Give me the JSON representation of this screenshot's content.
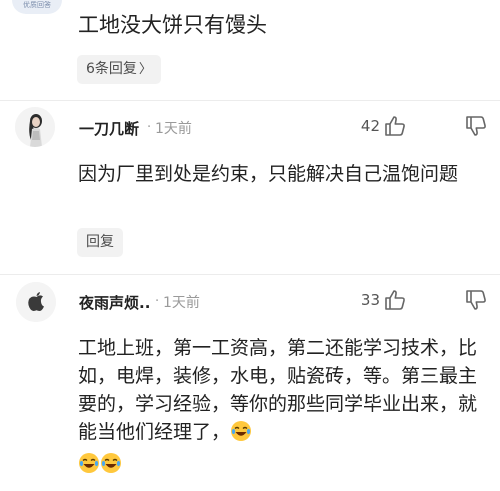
{
  "top_comment": {
    "avatar_fragment_text": "优质回答",
    "text": "工地没大饼只有馒头",
    "replies_label": "6条回复",
    "replies_chevron": "〉"
  },
  "comments": [
    {
      "username": "一刀几断",
      "separator": "·",
      "time": "1天前",
      "likes": "42",
      "text": "因为厂里到处是约束，只能解决自己温饱问题",
      "reply_label": "回复",
      "avatar_icon": "portrait-avatar",
      "like_icon": "thumbs-up-icon",
      "dislike_icon": "thumbs-down-icon"
    },
    {
      "username": "夜雨声烦..",
      "separator": "·",
      "time": "1天前",
      "likes": "33",
      "text": "工地上班，第一工资高，第二还能学习技术，比如，电焊，装修，水电，贴瓷砖，等。第三最主要的，学习经验，等你的那些同学毕业出来，就能当他们经理了，",
      "emoji_names": [
        "laugh-cry-emoji",
        "laugh-cry-emoji",
        "laugh-cry-emoji"
      ],
      "avatar_icon": "apple-logo-avatar",
      "like_icon": "thumbs-up-icon",
      "dislike_icon": "thumbs-down-icon"
    }
  ],
  "colors": {
    "text": "#222222",
    "meta": "#9a9a9a",
    "pill_bg": "#f2f2f2",
    "emoji_face": "#ffc83d"
  }
}
